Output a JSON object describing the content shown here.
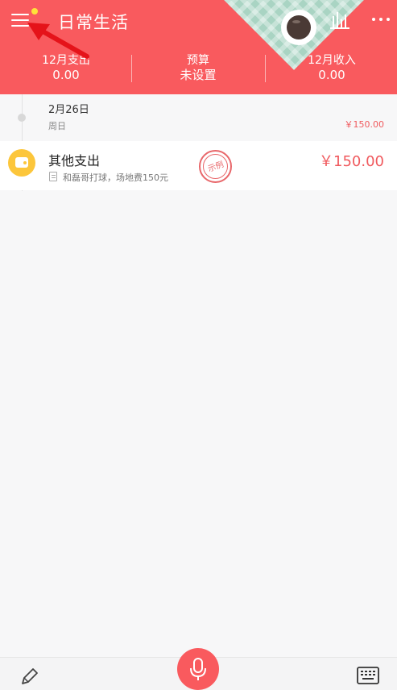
{
  "header": {
    "title": "日常生活",
    "menu_icon": "hamburger-menu-icon",
    "notification_color": "#ffe23a",
    "accent": "#f95a5e",
    "stats": [
      {
        "label": "12月支出",
        "value": "0.00"
      },
      {
        "label": "预算",
        "value": "未设置"
      },
      {
        "label": "12月收入",
        "value": "0.00"
      }
    ]
  },
  "day_group": {
    "date": "2月26日",
    "weekday": "周日",
    "total": "￥150.00"
  },
  "entries": [
    {
      "category": "其他支出",
      "icon": "wallet-icon",
      "note": "和磊哥打球，场地费150元",
      "stamp": "示例",
      "amount": "￥150.00"
    }
  ],
  "bottom_bar": {
    "left_icon": "pencil-icon",
    "center_icon": "microphone-icon",
    "right_icon": "keyboard-icon"
  }
}
